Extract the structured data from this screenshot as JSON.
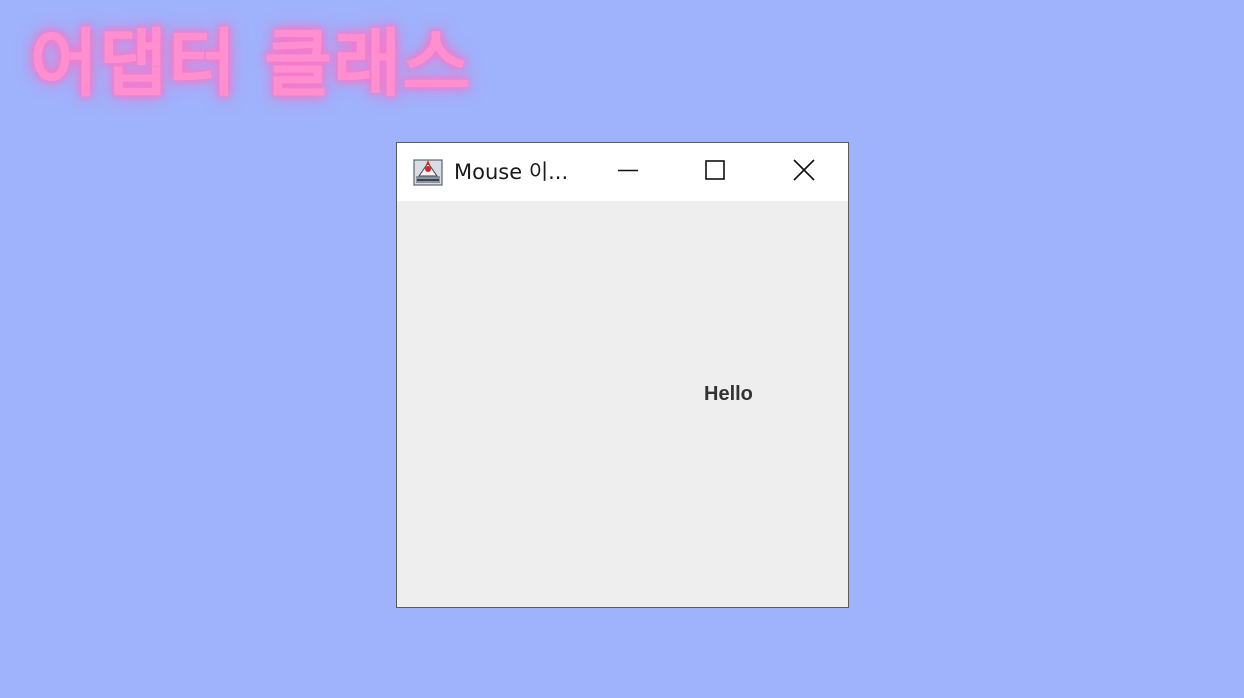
{
  "heading": {
    "text": "어댑터 클래스",
    "color": "#ff8fcf"
  },
  "background_color": "#9fb2fc",
  "window": {
    "title": "Mouse 이...",
    "icon": "java-app-icon",
    "controls": {
      "minimize": "minimize-icon",
      "maximize": "maximize-icon",
      "close": "close-icon"
    },
    "label": {
      "text": "Hello"
    }
  }
}
